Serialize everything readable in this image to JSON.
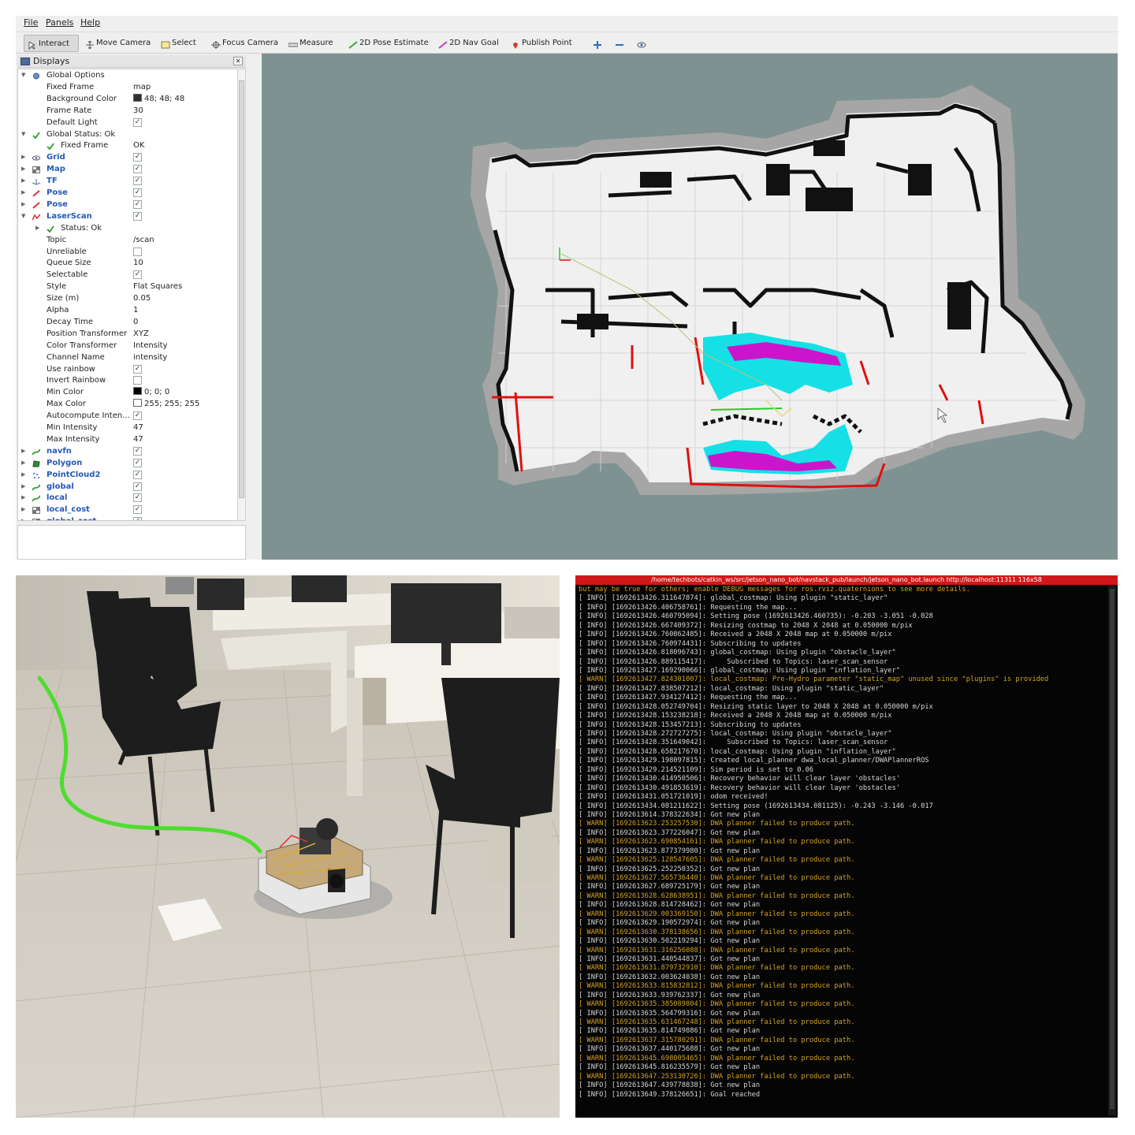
{
  "menu": [
    "File",
    "Panels",
    "Help"
  ],
  "toolbar": {
    "tools": [
      "Interact",
      "Move Camera",
      "Select",
      "Focus Camera",
      "Measure",
      "2D Pose Estimate",
      "2D Nav Goal",
      "Publish Point"
    ],
    "active": "Interact",
    "icon_names": [
      "cursor-icon",
      "move-camera-icon",
      "select-icon",
      "focus-camera-icon",
      "measure-icon",
      "pose-estimate-icon",
      "nav-goal-icon",
      "publish-point-icon",
      "add-tool-icon",
      "remove-tool-icon",
      "eye-icon"
    ]
  },
  "displays": {
    "title": "Displays",
    "rows": [
      {
        "label": "Global Options",
        "value": "",
        "check": "none",
        "expand": "down",
        "icon": "gear-icon",
        "indent": 0,
        "blue": false
      },
      {
        "label": "Fixed Frame",
        "value": "map",
        "check": "none",
        "expand": "",
        "icon": "",
        "indent": 1,
        "blue": false
      },
      {
        "label": "Background Color",
        "value": "48; 48; 48",
        "swatch": "#303030",
        "check": "none",
        "expand": "",
        "icon": "",
        "indent": 1,
        "blue": false
      },
      {
        "label": "Frame Rate",
        "value": "30",
        "check": "none",
        "expand": "",
        "icon": "",
        "indent": 1,
        "blue": false
      },
      {
        "label": "Default Light",
        "value": "",
        "check": "on",
        "expand": "",
        "icon": "",
        "indent": 1,
        "blue": false
      },
      {
        "label": "Global Status: Ok",
        "value": "",
        "check": "none",
        "expand": "down",
        "icon": "checkmark-icon",
        "indent": 0,
        "blue": false
      },
      {
        "label": "Fixed Frame",
        "value": "OK",
        "check": "none",
        "expand": "",
        "icon": "checkmark-icon",
        "indent": 1,
        "blue": false
      },
      {
        "label": "Grid",
        "value": "",
        "check": "on",
        "expand": "right",
        "icon": "grid-icon",
        "indent": 0,
        "blue": true
      },
      {
        "label": "Map",
        "value": "",
        "check": "on",
        "expand": "right",
        "icon": "map-icon",
        "indent": 0,
        "blue": true
      },
      {
        "label": "TF",
        "value": "",
        "check": "on",
        "expand": "right",
        "icon": "tf-icon",
        "indent": 0,
        "blue": true
      },
      {
        "label": "Pose",
        "value": "",
        "check": "on",
        "expand": "right",
        "icon": "pose-icon",
        "indent": 0,
        "blue": true
      },
      {
        "label": "Pose",
        "value": "",
        "check": "on",
        "expand": "right",
        "icon": "pose-icon",
        "indent": 0,
        "blue": true
      },
      {
        "label": "LaserScan",
        "value": "",
        "check": "on",
        "expand": "down",
        "icon": "laserscan-icon",
        "indent": 0,
        "blue": true
      },
      {
        "label": "Status: Ok",
        "value": "",
        "check": "none",
        "expand": "right",
        "icon": "checkmark-icon",
        "indent": 1,
        "blue": false
      },
      {
        "label": "Topic",
        "value": "/scan",
        "check": "none",
        "expand": "",
        "icon": "",
        "indent": 1,
        "blue": false
      },
      {
        "label": "Unreliable",
        "value": "",
        "check": "off",
        "expand": "",
        "icon": "",
        "indent": 1,
        "blue": false
      },
      {
        "label": "Queue Size",
        "value": "10",
        "check": "none",
        "expand": "",
        "icon": "",
        "indent": 1,
        "blue": false
      },
      {
        "label": "Selectable",
        "value": "",
        "check": "on",
        "expand": "",
        "icon": "",
        "indent": 1,
        "blue": false
      },
      {
        "label": "Style",
        "value": "Flat Squares",
        "check": "none",
        "expand": "",
        "icon": "",
        "indent": 1,
        "blue": false
      },
      {
        "label": "Size (m)",
        "value": "0.05",
        "check": "none",
        "expand": "",
        "icon": "",
        "indent": 1,
        "blue": false
      },
      {
        "label": "Alpha",
        "value": "1",
        "check": "none",
        "expand": "",
        "icon": "",
        "indent": 1,
        "blue": false
      },
      {
        "label": "Decay Time",
        "value": "0",
        "check": "none",
        "expand": "",
        "icon": "",
        "indent": 1,
        "blue": false
      },
      {
        "label": "Position Transformer",
        "value": "XYZ",
        "check": "none",
        "expand": "",
        "icon": "",
        "indent": 1,
        "blue": false
      },
      {
        "label": "Color Transformer",
        "value": "Intensity",
        "check": "none",
        "expand": "",
        "icon": "",
        "indent": 1,
        "blue": false
      },
      {
        "label": "Channel Name",
        "value": "intensity",
        "check": "none",
        "expand": "",
        "icon": "",
        "indent": 1,
        "blue": false
      },
      {
        "label": "Use rainbow",
        "value": "",
        "check": "on",
        "expand": "",
        "icon": "",
        "indent": 1,
        "blue": false
      },
      {
        "label": "Invert Rainbow",
        "value": "",
        "check": "off",
        "expand": "",
        "icon": "",
        "indent": 1,
        "blue": false
      },
      {
        "label": "Min Color",
        "value": "0; 0; 0",
        "swatch": "#000000",
        "check": "none",
        "expand": "",
        "icon": "",
        "indent": 1,
        "blue": false
      },
      {
        "label": "Max Color",
        "value": "255; 255; 255",
        "swatch": "#ffffff",
        "check": "none",
        "expand": "",
        "icon": "",
        "indent": 1,
        "blue": false
      },
      {
        "label": "Autocompute Inten...",
        "value": "",
        "check": "on",
        "expand": "",
        "icon": "",
        "indent": 1,
        "blue": false
      },
      {
        "label": "Min Intensity",
        "value": "47",
        "check": "none",
        "expand": "",
        "icon": "",
        "indent": 1,
        "blue": false
      },
      {
        "label": "Max Intensity",
        "value": "47",
        "check": "none",
        "expand": "",
        "icon": "",
        "indent": 1,
        "blue": false
      },
      {
        "label": "navfn",
        "value": "",
        "check": "on",
        "expand": "right",
        "icon": "path-icon",
        "indent": 0,
        "blue": true
      },
      {
        "label": "Polygon",
        "value": "",
        "check": "on",
        "expand": "right",
        "icon": "polygon-icon",
        "indent": 0,
        "blue": true
      },
      {
        "label": "PointCloud2",
        "value": "",
        "check": "on",
        "expand": "right",
        "icon": "pointcloud-icon",
        "indent": 0,
        "blue": true
      },
      {
        "label": "global",
        "value": "",
        "check": "on",
        "expand": "right",
        "icon": "path-icon",
        "indent": 0,
        "blue": true
      },
      {
        "label": "local",
        "value": "",
        "check": "on",
        "expand": "right",
        "icon": "path-icon",
        "indent": 0,
        "blue": true
      },
      {
        "label": "local_cost",
        "value": "",
        "check": "on",
        "expand": "right",
        "icon": "map-icon",
        "indent": 0,
        "blue": true
      },
      {
        "label": "global_cost",
        "value": "",
        "check": "on",
        "expand": "right",
        "icon": "map-icon",
        "indent": 0,
        "blue": true
      }
    ]
  },
  "colors": {
    "viewport_bg": "#7e9291",
    "free_space": "#f0f0f0",
    "inflation": "#a6a6a6",
    "wall": "#111111",
    "laser": "#e01010",
    "costmap_cyan": "#14e0e6",
    "costmap_magenta": "#cc14cc",
    "path_green": "#22cc22",
    "terminal_title_bg": "#d11818",
    "warn": "#d3a224",
    "info": "#d6d6d6"
  },
  "terminal": {
    "title": "/home/techbots/catkin_ws/src/jetson_nano_bot/navstack_pub/launch/jetson_nano_bot.launch http://localhost:11311 116x58",
    "lines": [
      {
        "level": "PLAIN",
        "text": "but may be true for others; enable DEBUG messages for ros.rviz.quaternions to see more details."
      },
      {
        "level": "INFO",
        "text": "[ INFO] [1692613426.311647874]: global_costmap: Using plugin \"static_layer\""
      },
      {
        "level": "INFO",
        "text": "[ INFO] [1692613426.406758761]: Requesting the map..."
      },
      {
        "level": "INFO",
        "text": "[ INFO] [1692613426.460795094]: Setting pose (1692613426.460735): -0.203 -3.051 -0.028"
      },
      {
        "level": "INFO",
        "text": "[ INFO] [1692613426.667409372]: Resizing costmap to 2048 X 2048 at 0.050000 m/pix"
      },
      {
        "level": "INFO",
        "text": "[ INFO] [1692613426.760862485]: Received a 2048 X 2048 map at 0.050000 m/pix"
      },
      {
        "level": "INFO",
        "text": "[ INFO] [1692613426.760974431]: Subscribing to updates"
      },
      {
        "level": "INFO",
        "text": "[ INFO] [1692613426.818096743]: global_costmap: Using plugin \"obstacle_layer\""
      },
      {
        "level": "INFO",
        "text": "[ INFO] [1692613426.889115417]:     Subscribed to Topics: laser_scan_sensor"
      },
      {
        "level": "INFO",
        "text": "[ INFO] [1692613427.169290066]: global_costmap: Using plugin \"inflation_layer\""
      },
      {
        "level": "WARN",
        "text": "[ WARN] [1692613427.824301007]: local_costmap: Pre-Hydro parameter \"static_map\" unused since \"plugins\" is provided"
      },
      {
        "level": "INFO",
        "text": "[ INFO] [1692613427.838507212]: local_costmap: Using plugin \"static_layer\""
      },
      {
        "level": "INFO",
        "text": "[ INFO] [1692613427.934127412]: Requesting the map..."
      },
      {
        "level": "INFO",
        "text": "[ INFO] [1692613428.052749704]: Resizing static layer to 2048 X 2048 at 0.050000 m/pix"
      },
      {
        "level": "INFO",
        "text": "[ INFO] [1692613428.153238218]: Received a 2048 X 2048 map at 0.050000 m/pix"
      },
      {
        "level": "INFO",
        "text": "[ INFO] [1692613428.153457213]: Subscribing to updates"
      },
      {
        "level": "INFO",
        "text": "[ INFO] [1692613428.272727275]: local_costmap: Using plugin \"obstacle_layer\""
      },
      {
        "level": "INFO",
        "text": "[ INFO] [1692613428.351649042]:     Subscribed to Topics: laser_scan_sensor"
      },
      {
        "level": "INFO",
        "text": "[ INFO] [1692613428.658217670]: local_costmap: Using plugin \"inflation_layer\""
      },
      {
        "level": "INFO",
        "text": "[ INFO] [1692613429.198097815]: Created local_planner dwa_local_planner/DWAPlannerROS"
      },
      {
        "level": "INFO",
        "text": "[ INFO] [1692613429.214521109]: Sim period is set to 0.06"
      },
      {
        "level": "INFO",
        "text": "[ INFO] [1692613430.414950506]: Recovery behavior will clear layer 'obstacles'"
      },
      {
        "level": "INFO",
        "text": "[ INFO] [1692613430.491853619]: Recovery behavior will clear layer 'obstacles'"
      },
      {
        "level": "INFO",
        "text": "[ INFO] [1692613431.051721019]: odom received!"
      },
      {
        "level": "INFO",
        "text": "[ INFO] [1692613434.081211622]: Setting pose (1692613434.081125): -0.243 -3.146 -0.017"
      },
      {
        "level": "INFO",
        "text": "[ INFO] [1692613614.378322634]: Got new plan"
      },
      {
        "level": "WARN",
        "text": "[ WARN] [1692613623.253257530]: DWA planner failed to produce path."
      },
      {
        "level": "INFO",
        "text": "[ INFO] [1692613623.377226047]: Got new plan"
      },
      {
        "level": "WARN",
        "text": "[ WARN] [1692613623.690854161]: DWA planner failed to produce path."
      },
      {
        "level": "INFO",
        "text": "[ INFO] [1692613623.877379980]: Got new plan"
      },
      {
        "level": "WARN",
        "text": "[ WARN] [1692613625.128547605]: DWA planner failed to produce path."
      },
      {
        "level": "INFO",
        "text": "[ INFO] [1692613625.252250352]: Got new plan"
      },
      {
        "level": "WARN",
        "text": "[ WARN] [1692613627.565736440]: DWA planner failed to produce path."
      },
      {
        "level": "INFO",
        "text": "[ INFO] [1692613627.689725179]: Got new plan"
      },
      {
        "level": "WARN",
        "text": "[ WARN] [1692613628.628638951]: DWA planner failed to produce path."
      },
      {
        "level": "INFO",
        "text": "[ INFO] [1692613628.814728462]: Got new plan"
      },
      {
        "level": "WARN",
        "text": "[ WARN] [1692613629.003369150]: DWA planner failed to produce path."
      },
      {
        "level": "INFO",
        "text": "[ INFO] [1692613629.190572974]: Got new plan"
      },
      {
        "level": "WARN",
        "text": "[ WARN] [1692613630.378138656]: DWA planner failed to produce path."
      },
      {
        "level": "INFO",
        "text": "[ INFO] [1692613630.502219294]: Got new plan"
      },
      {
        "level": "WARN",
        "text": "[ WARN] [1692613631.316256088]: DWA planner failed to produce path."
      },
      {
        "level": "INFO",
        "text": "[ INFO] [1692613631.440544837]: Got new plan"
      },
      {
        "level": "WARN",
        "text": "[ WARN] [1692613631.879732910]: DWA planner failed to produce path."
      },
      {
        "level": "INFO",
        "text": "[ INFO] [1692613632.003624038]: Got new plan"
      },
      {
        "level": "WARN",
        "text": "[ WARN] [1692613633.815832812]: DWA planner failed to produce path."
      },
      {
        "level": "INFO",
        "text": "[ INFO] [1692613633.939762337]: Got new plan"
      },
      {
        "level": "WARN",
        "text": "[ WARN] [1692613635.385089804]: DWA planner failed to produce path."
      },
      {
        "level": "INFO",
        "text": "[ INFO] [1692613635.564799316]: Got new plan"
      },
      {
        "level": "WARN",
        "text": "[ WARN] [1692613635.631467248]: DWA planner failed to produce path."
      },
      {
        "level": "INFO",
        "text": "[ INFO] [1692613635.814749886]: Got new plan"
      },
      {
        "level": "WARN",
        "text": "[ WARN] [1692613637.315780291]: DWA planner failed to produce path."
      },
      {
        "level": "INFO",
        "text": "[ INFO] [1692613637.440175688]: Got new plan"
      },
      {
        "level": "WARN",
        "text": "[ WARN] [1692613645.698005465]: DWA planner failed to produce path."
      },
      {
        "level": "INFO",
        "text": "[ INFO] [1692613645.816235579]: Got new plan"
      },
      {
        "level": "WARN",
        "text": "[ WARN] [1692613647.253130726]: DWA planner failed to produce path."
      },
      {
        "level": "INFO",
        "text": "[ INFO] [1692613647.439778838]: Got new plan"
      },
      {
        "level": "INFO",
        "text": "[ INFO] [1692613649.378126651]: Goal reached"
      }
    ]
  }
}
